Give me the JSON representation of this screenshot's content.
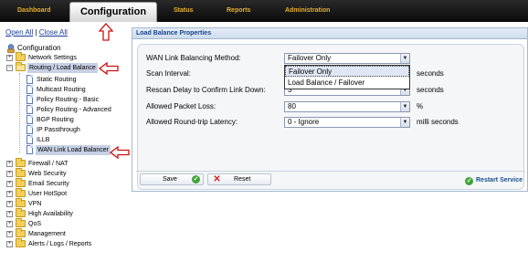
{
  "nav": {
    "dashboard": "Dashboard",
    "configuration": "Configuration",
    "status": "Status",
    "reports": "Reports",
    "administration": "Administration"
  },
  "tree_links": {
    "open_all": "Open All",
    "separator": "|",
    "close_all": "Close All"
  },
  "tree": {
    "root": "Configuration",
    "network_settings": "Network Settings",
    "routing": "Routing / Load Balance",
    "routing_children": [
      "Static Routing",
      "Multicast Routing",
      "Policy Routing - Basic",
      "Policy Routing - Advanced",
      "BGP Routing",
      "IP Passthrough",
      "ILLB",
      "WAN Link Load Balancer"
    ],
    "others": [
      "Firewall / NAT",
      "Web Security",
      "Email Security",
      "User HotSpot",
      "VPN",
      "High Availability",
      "QoS",
      "Management",
      "Alerts / Logs / Reports"
    ]
  },
  "panel": {
    "title": "Load Balance Properties",
    "fields": {
      "method_label": "WAN Link Balancing Method:",
      "method_value": "Failover Only",
      "scan_label": "Scan Interval:",
      "scan_unit": "seconds",
      "rescan_label": "Rescan Delay to Confirm Link Down:",
      "rescan_value": "3",
      "rescan_unit": "seconds",
      "packet_loss_label": "Allowed Packet Loss:",
      "packet_loss_value": "80",
      "packet_loss_unit": "%",
      "latency_label": "Allowed Round-trip Latency:",
      "latency_value": "0 - Ignore",
      "latency_unit": "milli seconds"
    },
    "method_options": [
      "Failover Only",
      "Load Balance / Failover"
    ],
    "save_label": "Save",
    "reset_label": "Reset",
    "restart_label": "Restart Service"
  },
  "colors": {
    "nav_text": "#e8b02a",
    "annotation_red": "#cc1111",
    "panel_border": "#a3b8cf",
    "link_blue": "#1a3d9c"
  }
}
